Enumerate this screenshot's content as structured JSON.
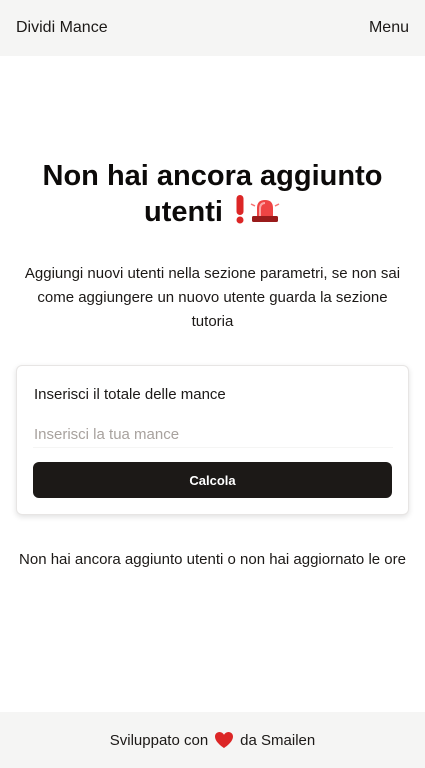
{
  "header": {
    "brand": "Dividi Mance",
    "menu_label": "Menu"
  },
  "main": {
    "title": "Non hai ancora aggiunto utenti",
    "title_icons": [
      "exclamation-icon",
      "siren-icon"
    ],
    "subtitle": "Aggiungi nuovi utenti nella sezione parametri, se non sai come aggiungere un nuovo utente guarda la sezione tutoria",
    "card": {
      "label": "Inserisci il totale delle mance",
      "input_placeholder": "Inserisci la tua mance",
      "input_value": "",
      "button_label": "Calcola"
    },
    "result_text": "Non hai ancora aggiunto utenti o non hai aggiornato le ore"
  },
  "footer": {
    "prefix": "Sviluppato con",
    "icon": "heart-icon",
    "suffix": "da Smailen"
  },
  "colors": {
    "header_bg": "#f5f5f4",
    "button_bg": "#1c1917",
    "heart": "#dc2626"
  }
}
